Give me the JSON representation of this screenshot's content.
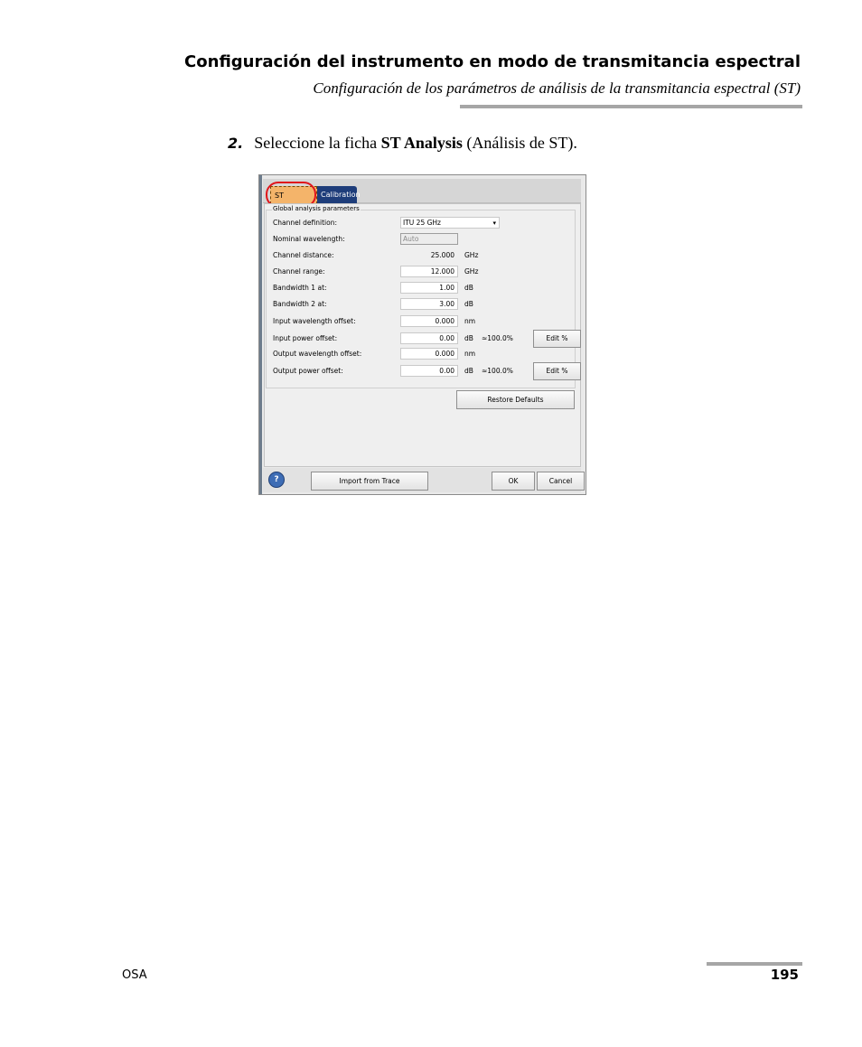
{
  "header": {
    "title": "Configuración del instrumento en modo de transmitancia espectral",
    "subtitle": "Configuración de los parámetros de análisis de la transmitancia espectral (ST)"
  },
  "step": {
    "number": "2.",
    "text_before": "Seleccione la ficha",
    "bold": "ST Analysis",
    "text_after": "(Análisis de ST)."
  },
  "dialog": {
    "tabs": {
      "st_analysis": "ST Analysis",
      "calibration": "Calibration"
    },
    "group_label": "Global analysis parameters",
    "rows": [
      {
        "label": "Channel definition:",
        "value": "ITU 25 GHz",
        "unit": "",
        "kind": "select"
      },
      {
        "label": "Nominal wavelength:",
        "value": "Auto",
        "unit": "",
        "kind": "disabled"
      },
      {
        "label": "Channel distance:",
        "value": "25.000",
        "unit": "GHz",
        "kind": "plain"
      },
      {
        "label": "Channel range:",
        "value": "12.000",
        "unit": "GHz",
        "kind": "input"
      },
      {
        "label": "Bandwidth 1 at:",
        "value": "1.00",
        "unit": "dB",
        "kind": "input"
      },
      {
        "label": "Bandwidth 2 at:",
        "value": "3.00",
        "unit": "dB",
        "kind": "input"
      },
      {
        "label": "Input wavelength offset:",
        "value": "0.000",
        "unit": "nm",
        "kind": "input"
      },
      {
        "label": "Input power offset:",
        "value": "0.00",
        "unit": "dB",
        "kind": "input",
        "pct": "≈100.0%",
        "button": "Edit %"
      },
      {
        "label": "Output wavelength offset:",
        "value": "0.000",
        "unit": "nm",
        "kind": "input"
      },
      {
        "label": "Output power offset:",
        "value": "0.00",
        "unit": "dB",
        "kind": "input",
        "pct": "≈100.0%",
        "button": "Edit %"
      }
    ],
    "restore_defaults": "Restore Defaults",
    "footer": {
      "help": "?",
      "import": "Import from Trace",
      "ok": "OK",
      "cancel": "Cancel"
    }
  },
  "page_footer": {
    "left": "OSA",
    "page_number": "195"
  }
}
